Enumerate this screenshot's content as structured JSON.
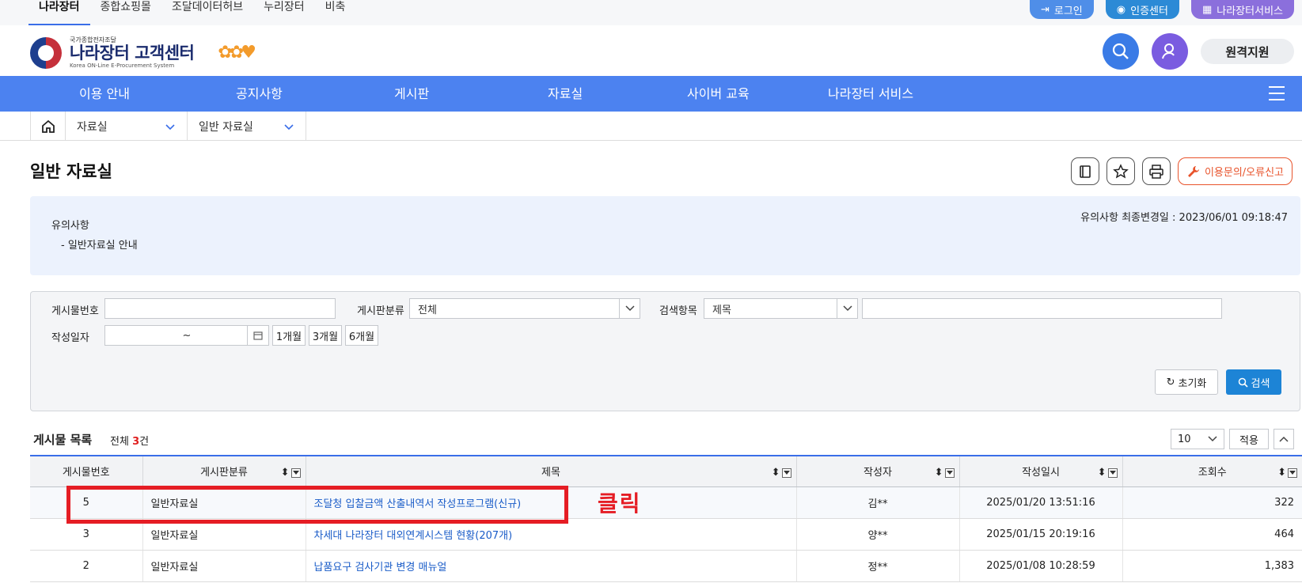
{
  "top_links": [
    "나라장터",
    "종합쇼핑몰",
    "조달데이터허브",
    "누리장터",
    "비축"
  ],
  "top_buttons": {
    "login": "로그인",
    "cert": "인증센터",
    "service": "나라장터서비스"
  },
  "logo": {
    "small": "국가종합전자조달",
    "main": "나라장터 고객센터",
    "english": "Korea ON-Line E-Procurement System"
  },
  "header": {
    "remote_label": "원격지원"
  },
  "gnb": [
    "이용 안내",
    "공지사항",
    "게시판",
    "자료실",
    "사이버 교육",
    "나라장터 서비스"
  ],
  "breadcrumb": {
    "level1": "자료실",
    "level2": "일반 자료실"
  },
  "page": {
    "title": "일반 자료실",
    "report_label": "이용문의/오류신고"
  },
  "notice": {
    "heading": "유의사항",
    "item": "- 일반자료실 안내",
    "updated": "유의사항 최종변경일 : 2023/06/01 09:18:47"
  },
  "search": {
    "post_no_label": "게시물번호",
    "category_label": "게시판분류",
    "category_value": "전체",
    "field_label": "검색항목",
    "field_value": "제목",
    "date_label": "작성일자",
    "date_sep": "~",
    "range_1m": "1개월",
    "range_3m": "3개월",
    "range_6m": "6개월",
    "reset_label": "초기화",
    "search_label": "검색"
  },
  "list": {
    "title": "게시물 목록",
    "total_prefix": "전체 ",
    "total_count": "3",
    "total_suffix": "건",
    "page_size": "10",
    "apply_label": "적용",
    "columns": {
      "no": "게시물번호",
      "category": "게시판분류",
      "subject": "제목",
      "author": "작성자",
      "date": "작성일시",
      "views": "조회수"
    },
    "rows": [
      {
        "no": "5",
        "category": "일반자료실",
        "subject": "조달청 입찰금액 산출내역서 작성프로그램(신규)",
        "author": "김**",
        "date": "2025/01/20 13:51:16",
        "views": "322"
      },
      {
        "no": "3",
        "category": "일반자료실",
        "subject": "차세대 나라장터 대외연계시스템 현황(207개)",
        "author": "양**",
        "date": "2025/01/15 20:19:16",
        "views": "464"
      },
      {
        "no": "2",
        "category": "일반자료실",
        "subject": "납품요구 검사기관 변경 매뉴얼",
        "author": "정**",
        "date": "2025/01/08 10:28:59",
        "views": "1,383"
      }
    ]
  },
  "annotation": {
    "click_label": "클릭"
  }
}
